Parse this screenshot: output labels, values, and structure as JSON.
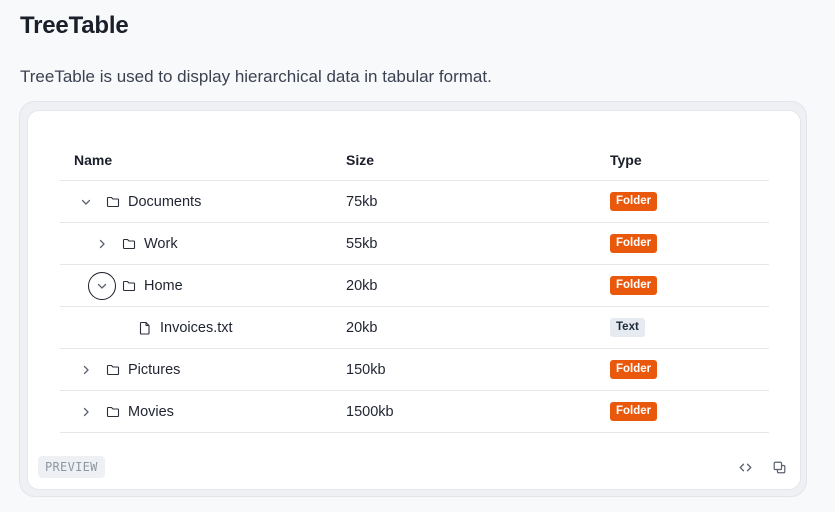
{
  "page": {
    "title": "TreeTable",
    "description": "TreeTable is used to display hierarchical data in tabular format."
  },
  "table": {
    "columns": [
      "Name",
      "Size",
      "Type"
    ],
    "rows": [
      {
        "name": "Documents",
        "size": "75kb",
        "type": "Folder",
        "level": 0,
        "expander": "expanded",
        "icon": "folder-icon"
      },
      {
        "name": "Work",
        "size": "55kb",
        "type": "Folder",
        "level": 1,
        "expander": "collapsed",
        "icon": "folder-icon"
      },
      {
        "name": "Home",
        "size": "20kb",
        "type": "Folder",
        "level": 1,
        "expander": "expanded",
        "icon": "folder-icon",
        "focused": true
      },
      {
        "name": "Invoices.txt",
        "size": "20kb",
        "type": "Text",
        "level": 2,
        "expander": "none",
        "icon": "file-icon"
      },
      {
        "name": "Pictures",
        "size": "150kb",
        "type": "Folder",
        "level": 0,
        "expander": "collapsed",
        "icon": "folder-icon"
      },
      {
        "name": "Movies",
        "size": "1500kb",
        "type": "Folder",
        "level": 0,
        "expander": "collapsed",
        "icon": "folder-icon"
      }
    ]
  },
  "footer": {
    "preview_label": "PREVIEW",
    "tools": [
      "code-icon",
      "copy-icon"
    ]
  },
  "colors": {
    "folder_badge": "#ea580c",
    "text_badge": "#e6ebf1",
    "focus_ring": "#1b1f2a"
  }
}
